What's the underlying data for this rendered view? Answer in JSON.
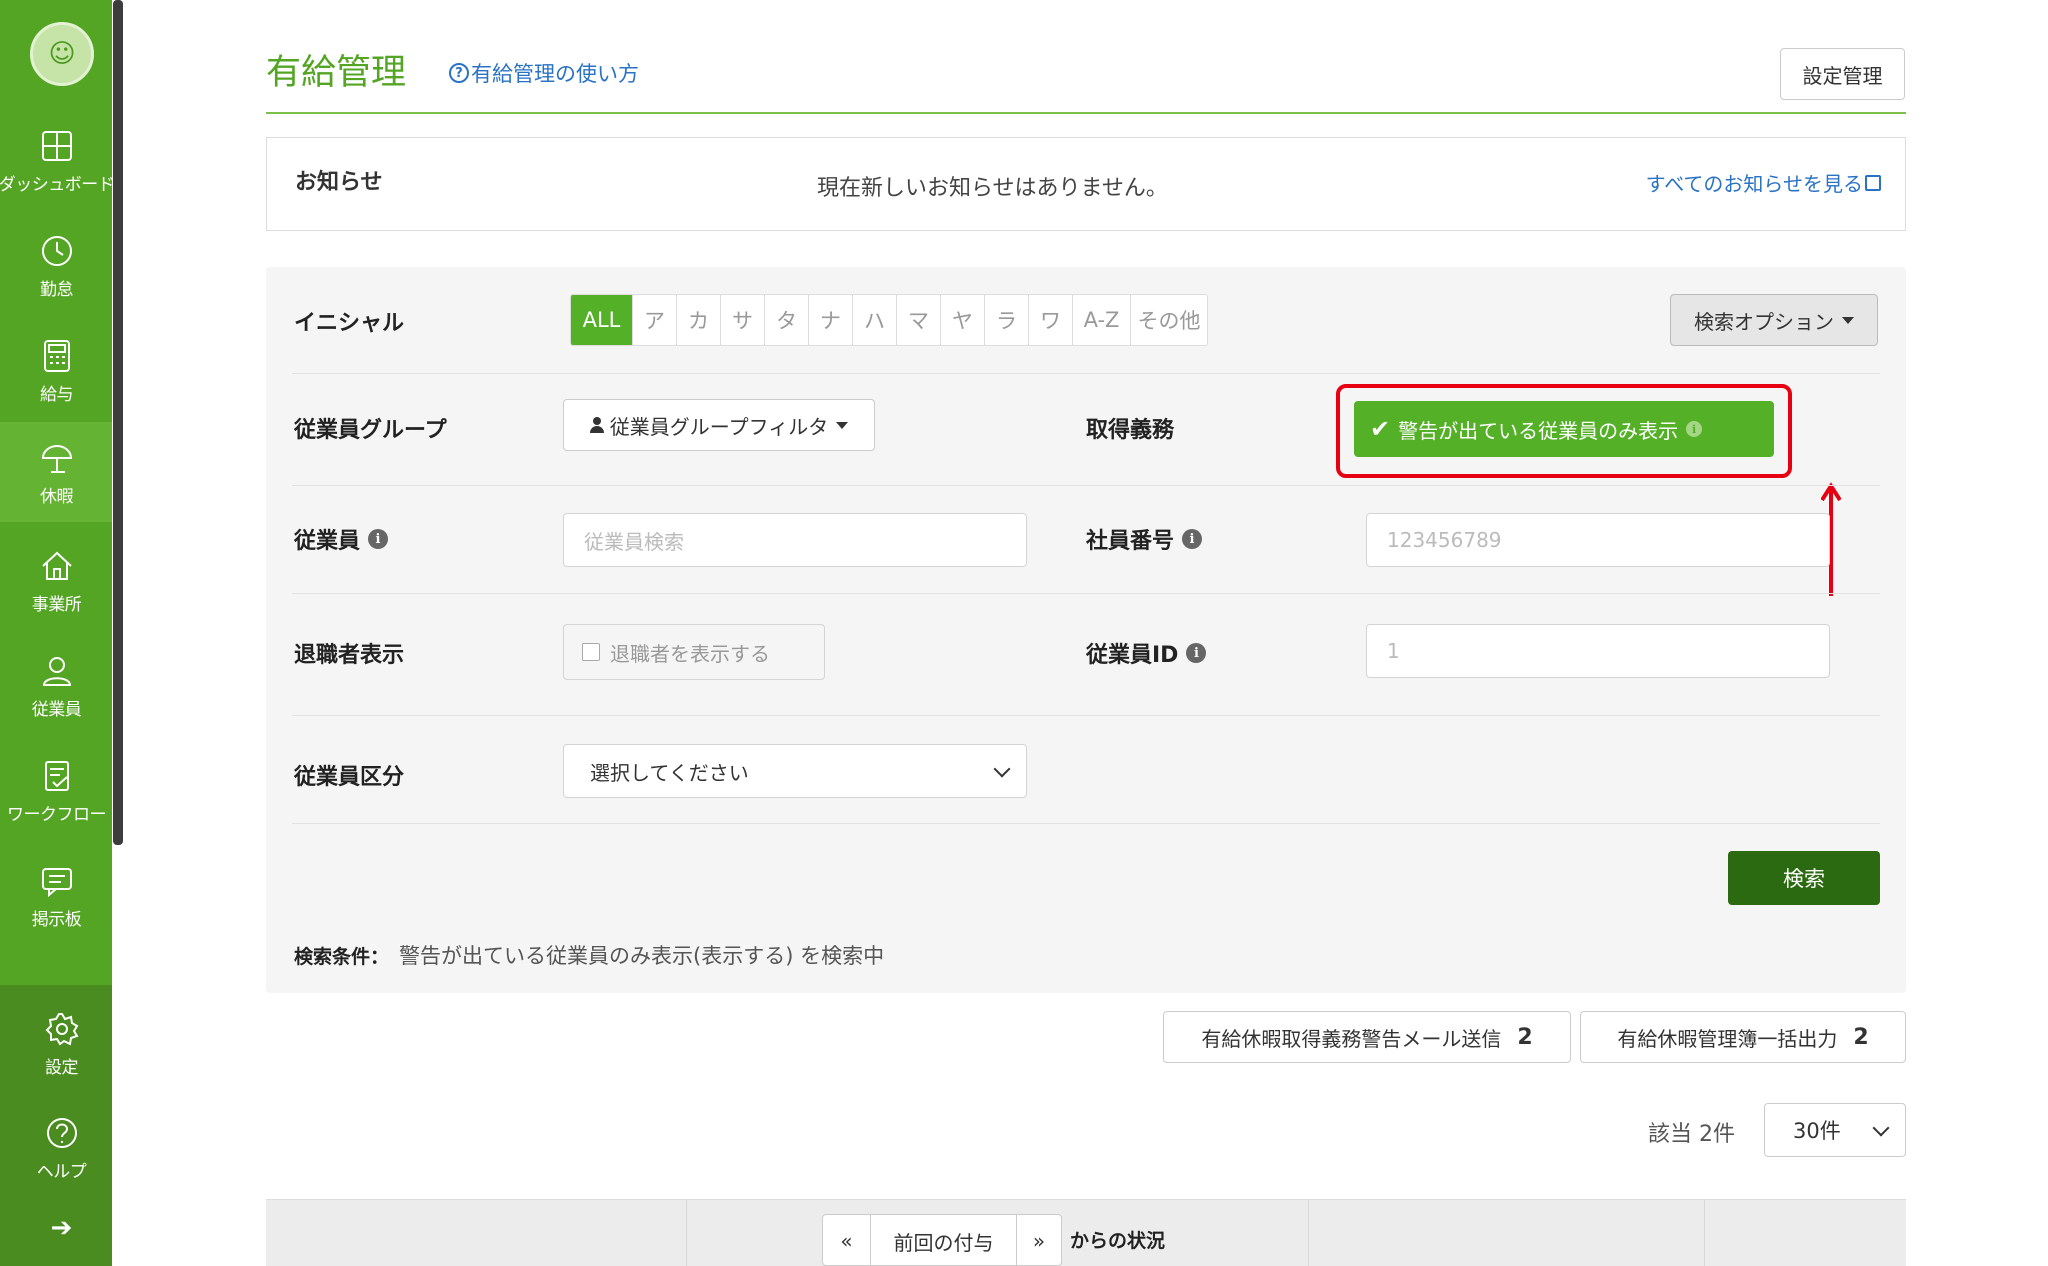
{
  "sidebar": {
    "items": [
      {
        "label": "ダッシュボード",
        "icon": "dashboard-icon"
      },
      {
        "label": "勤怠",
        "icon": "clock-icon"
      },
      {
        "label": "給与",
        "icon": "calculator-icon"
      },
      {
        "label": "休暇",
        "icon": "parasol-icon"
      },
      {
        "label": "事業所",
        "icon": "home-icon"
      },
      {
        "label": "従業員",
        "icon": "person-icon"
      },
      {
        "label": "ワークフロー",
        "icon": "workflow-icon"
      },
      {
        "label": "掲示板",
        "icon": "message-icon"
      }
    ],
    "bottom": [
      {
        "label": "設定",
        "icon": "gear-icon"
      },
      {
        "label": "ヘルプ",
        "icon": "help-icon"
      }
    ],
    "expand_glyph": "➔"
  },
  "header": {
    "title": "有給管理",
    "help_link": "有給管理の使い方",
    "settings_button": "設定管理"
  },
  "notice": {
    "label": "お知らせ",
    "message": "現在新しいお知らせはありません。",
    "link": "すべてのお知らせを見る"
  },
  "search": {
    "initial_label": "イニシャル",
    "initials": [
      "ALL",
      "ア",
      "カ",
      "サ",
      "タ",
      "ナ",
      "ハ",
      "マ",
      "ヤ",
      "ラ",
      "ワ",
      "A-Z",
      "その他"
    ],
    "initial_selected": "ALL",
    "options_button": "検索オプション",
    "group_label": "従業員グループ",
    "group_filter": "従業員グループフィルタ",
    "obligation_label": "取得義務",
    "warning_toggle": "警告が出ている従業員のみ表示",
    "employee_label": "従業員",
    "employee_placeholder": "従業員検索",
    "number_label": "社員番号",
    "number_placeholder": "123456789",
    "retired_label": "退職者表示",
    "retired_checkbox": "退職者を表示する",
    "employee_id_label": "従業員ID",
    "employee_id_placeholder": "1",
    "category_label": "従業員区分",
    "category_select": "選択してください",
    "search_button": "検索",
    "conditions_key": "検索条件：",
    "conditions_value": "警告が出ている従業員のみ表示(表示する) を検索中"
  },
  "actions": {
    "mail_button": "有給休暇取得義務警告メール送信",
    "mail_count": "2",
    "export_button": "有給休暇管理簿一括出力",
    "export_count": "2"
  },
  "results": {
    "total": "該当 2件",
    "per_page": "30件"
  },
  "table": {
    "prev_glyph": "«",
    "pager_label": "前回の付与",
    "next_glyph": "»",
    "status_label": "からの状況"
  },
  "colors": {
    "brand_green": "#54a524",
    "active_green": "#54b027",
    "dark_green": "#2b6a10",
    "highlight_red": "#e60012",
    "link_blue": "#2a73c4"
  }
}
